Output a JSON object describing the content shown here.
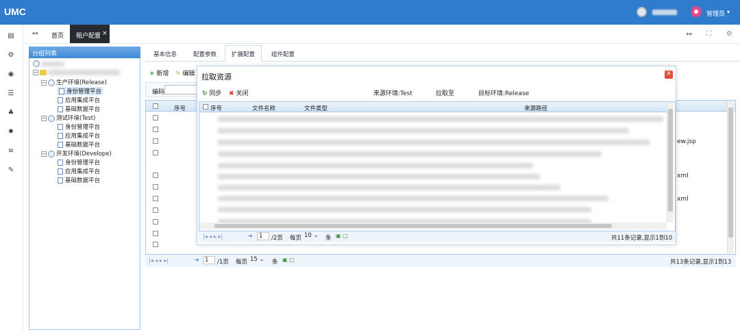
{
  "app": {
    "title": "UMC",
    "user_role": "管理员"
  },
  "tabs": {
    "home": "首页",
    "active": "租户配置",
    "close_glyph": "×"
  },
  "group_panel": {
    "title": "分组列表",
    "environments": [
      {
        "label": "生产环境(Release)",
        "children": [
          "身份管理平台",
          "应用集成平台",
          "基础数据平台"
        ]
      },
      {
        "label": "测试环境(Test)",
        "children": [
          "身份管理平台",
          "应用集成平台",
          "基础数据平台"
        ]
      },
      {
        "label": "开发环境(Develope)",
        "children": [
          "身份管理平台",
          "应用集成平台",
          "基础数据平台"
        ]
      }
    ]
  },
  "inner_tabs": [
    "基本信息",
    "配置参数",
    "扩展配置",
    "组件配置"
  ],
  "main_toolbar": {
    "add": "新增",
    "edit": "编辑",
    "code_label": "编码"
  },
  "main_grid": {
    "col_index": "序号",
    "row_fragments": [
      "ew.jsp",
      "xml",
      "xml"
    ],
    "pager": {
      "page": "1",
      "total_pages": "/1页",
      "per_page_label": "每页",
      "per_page": "15",
      "unit": "条",
      "summary": "共13条记录,显示1到13"
    }
  },
  "dialog": {
    "title": "拉取资源",
    "sync": "同步",
    "close": "关闭",
    "source_env": "来源环境:Test",
    "pull_to": "拉取至",
    "target_env": "目标环境:Release",
    "columns": {
      "index": "序号",
      "file_name": "文件名称",
      "file_type": "文件类型",
      "source_path": "来源路径"
    },
    "pager": {
      "page": "1",
      "total_pages": "/2页",
      "per_page_label": "每页",
      "per_page": "10",
      "unit": "条",
      "summary": "共11条记录,显示1到10"
    }
  },
  "colors": {
    "topbar": "#2f7bcc",
    "accent_pin": "#e04a8c",
    "close_red": "#e24d3a"
  }
}
